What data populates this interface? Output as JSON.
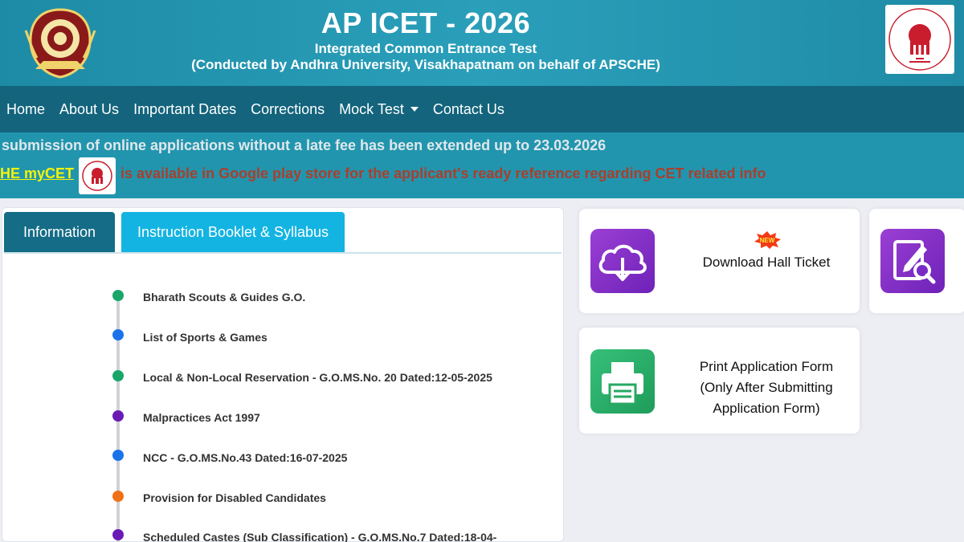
{
  "header": {
    "title": "AP ICET - 2026",
    "subtitle": "Integrated Common Entrance Test",
    "conducted_by": "(Conducted by Andhra University, Visakhapatnam on behalf of APSCHE)"
  },
  "nav": {
    "items": [
      {
        "label": "Home"
      },
      {
        "label": "About Us"
      },
      {
        "label": "Important Dates"
      },
      {
        "label": "Corrections"
      },
      {
        "label": "Mock Test"
      },
      {
        "label": "Contact Us"
      }
    ]
  },
  "marquee": {
    "line1": "submission of online applications without a late fee has been extended up to 23.03.2026",
    "link": "HE myCET",
    "line2": "is available in Google play store for the applicant's ready reference regarding CET related info"
  },
  "tabs": [
    {
      "label": "Information"
    },
    {
      "label": "Instruction Booklet & Syllabus"
    }
  ],
  "timeline": [
    {
      "text": "Bharath Scouts & Guides G.O.",
      "color": "#1aa56b"
    },
    {
      "text": "List of Sports & Games",
      "color": "#1a73e8"
    },
    {
      "text": "Local & Non-Local Reservation - G.O.MS.No. 20 Dated:12-05-2025",
      "color": "#1aa56b"
    },
    {
      "text": "Malpractices Act 1997",
      "color": "#6a1bb5"
    },
    {
      "text": "NCC - G.O.MS.No.43 Dated:16-07-2025",
      "color": "#1a73e8"
    },
    {
      "text": "Provision for Disabled Candidates",
      "color": "#f07017"
    },
    {
      "text": "Scheduled Castes (Sub Classification) - G.O.MS.No.7 Dated:18-04-",
      "color": "#6a1bb5"
    }
  ],
  "cards": {
    "hall_ticket": {
      "badge": "NEW",
      "label": "Download Hall Ticket"
    },
    "print_form": {
      "line1": "Print Application Form",
      "line2": "(Only After Submitting",
      "line3": "Application Form)"
    }
  },
  "colors": {
    "header_bg": "#2295ae",
    "nav_bg": "#13647c",
    "tab_active": "#146c86",
    "tab_secondary": "#13b4e2",
    "link_yellow": "#f2f40a",
    "marquee_red": "#a93f2c"
  }
}
